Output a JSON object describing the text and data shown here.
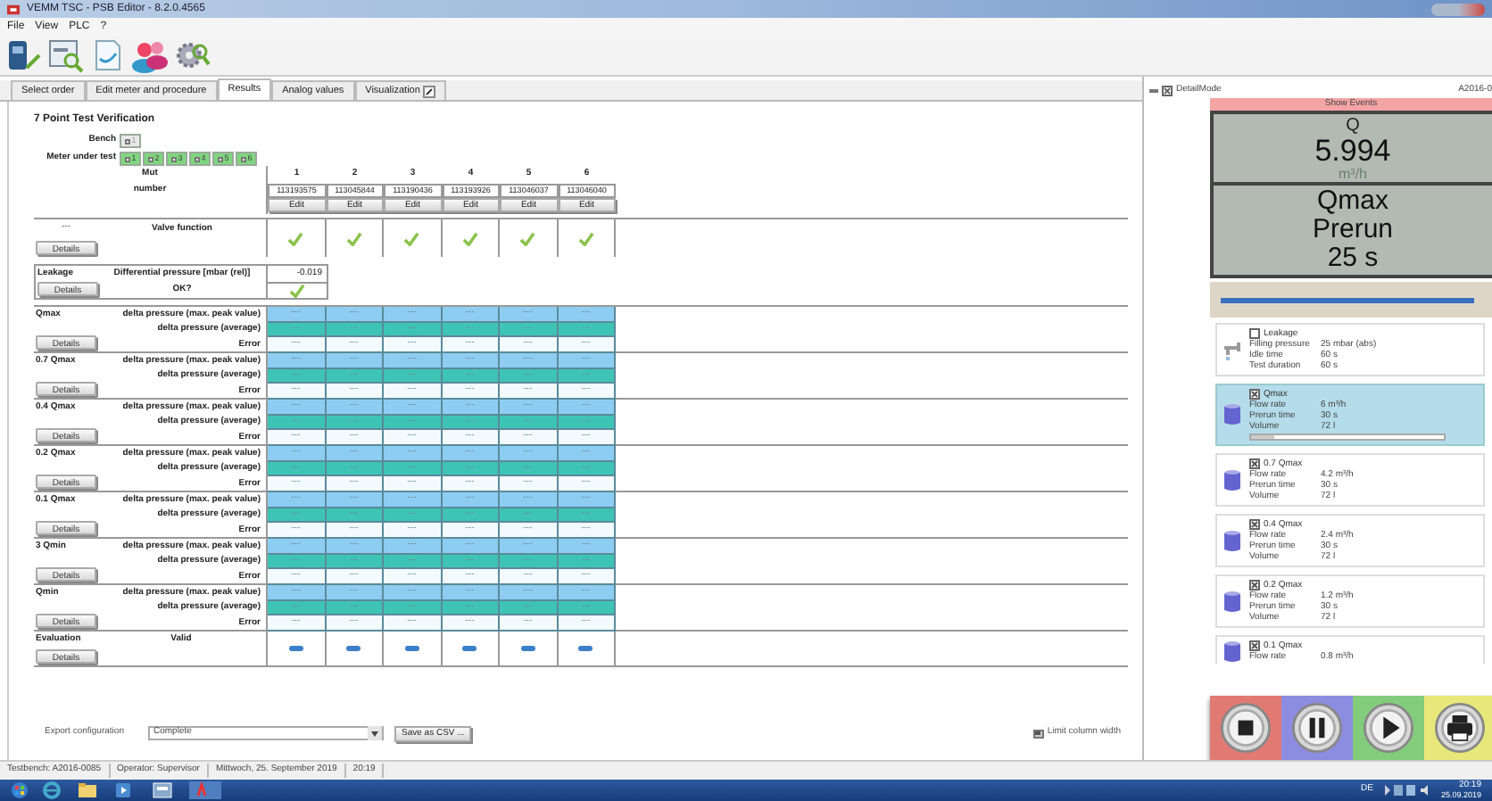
{
  "window": {
    "title": "VEMM TSC - PSB Editor - 8.2.0.4565"
  },
  "menu": [
    "File",
    "View",
    "PLC",
    "?"
  ],
  "tabs": [
    {
      "label": "Select order",
      "selected": false
    },
    {
      "label": "Edit meter and procedure",
      "selected": false
    },
    {
      "label": "Results",
      "selected": true
    },
    {
      "label": "Analog values",
      "selected": false
    },
    {
      "label": "Visualization",
      "selected": false
    }
  ],
  "results": {
    "title": "7 Point Test Verification",
    "bench": {
      "label": "Bench",
      "items": [
        {
          "label": "1",
          "checked": false
        }
      ]
    },
    "meters": {
      "label": "Meter under test",
      "items": [
        {
          "label": "1",
          "checked": true
        },
        {
          "label": "2",
          "checked": true
        },
        {
          "label": "3",
          "checked": true
        },
        {
          "label": "4",
          "checked": true
        },
        {
          "label": "5",
          "checked": true
        },
        {
          "label": "6",
          "checked": true
        }
      ]
    },
    "mut": {
      "label": "Mut",
      "columns": [
        "1",
        "2",
        "3",
        "4",
        "5",
        "6"
      ]
    },
    "number": {
      "label": "number",
      "values": [
        "113193575",
        "113045844",
        "113190436",
        "113193926",
        "113046037",
        "113046040"
      ]
    },
    "edit_buttons": [
      "Edit",
      "Edit",
      "Edit",
      "Edit",
      "Edit",
      "Edit"
    ],
    "valve": {
      "status": "---",
      "label": "Valve function",
      "details": "Details",
      "checks": [
        true,
        true,
        true,
        true,
        true,
        true
      ]
    },
    "leakage": {
      "title": "Leakage",
      "label": "Differential pressure [mbar (rel)]",
      "value": "-0.019",
      "ok_label": "OK?",
      "ok": true,
      "details": "Details"
    },
    "sections": [
      {
        "title": "Qmax",
        "details": "Details",
        "rows": [
          {
            "kind": "peak",
            "label": "delta pressure (max. peak value)",
            "cells": [
              "---",
              "---",
              "---",
              "---",
              "---",
              "---"
            ]
          },
          {
            "kind": "average",
            "label": "delta pressure (average)",
            "cells": [
              "---",
              "---",
              "---",
              "---",
              "---",
              "---"
            ]
          },
          {
            "kind": "error",
            "label": "Error",
            "cells": [
              "---",
              "---",
              "---",
              "---",
              "---",
              "---"
            ]
          }
        ]
      },
      {
        "title": "0.7 Qmax",
        "details": "Details",
        "rows": [
          {
            "kind": "peak",
            "label": "delta pressure (max. peak value)",
            "cells": [
              "---",
              "---",
              "---",
              "---",
              "---",
              "---"
            ]
          },
          {
            "kind": "average",
            "label": "delta pressure (average)",
            "cells": [
              "---",
              "---",
              "---",
              "---",
              "---",
              "---"
            ]
          },
          {
            "kind": "error",
            "label": "Error",
            "cells": [
              "---",
              "---",
              "---",
              "---",
              "---",
              "---"
            ]
          }
        ]
      },
      {
        "title": "0.4 Qmax",
        "details": "Details",
        "rows": [
          {
            "kind": "peak",
            "label": "delta pressure (max. peak value)",
            "cells": [
              "---",
              "---",
              "---",
              "---",
              "---",
              "---"
            ]
          },
          {
            "kind": "average",
            "label": "delta pressure (average)",
            "cells": [
              "---",
              "---",
              "---",
              "---",
              "---",
              "---"
            ]
          },
          {
            "kind": "error",
            "label": "Error",
            "cells": [
              "---",
              "---",
              "---",
              "---",
              "---",
              "---"
            ]
          }
        ]
      },
      {
        "title": "0.2 Qmax",
        "details": "Details",
        "rows": [
          {
            "kind": "peak",
            "label": "delta pressure (max. peak value)",
            "cells": [
              "---",
              "---",
              "---",
              "---",
              "---",
              "---"
            ]
          },
          {
            "kind": "average",
            "label": "delta pressure (average)",
            "cells": [
              "---",
              "---",
              "---",
              "---",
              "---",
              "---"
            ]
          },
          {
            "kind": "error",
            "label": "Error",
            "cells": [
              "---",
              "---",
              "---",
              "---",
              "---",
              "---"
            ]
          }
        ]
      },
      {
        "title": "0.1 Qmax",
        "details": "Details",
        "rows": [
          {
            "kind": "peak",
            "label": "delta pressure (max. peak value)",
            "cells": [
              "---",
              "---",
              "---",
              "---",
              "---",
              "---"
            ]
          },
          {
            "kind": "average",
            "label": "delta pressure (average)",
            "cells": [
              "---",
              "---",
              "---",
              "---",
              "---",
              "---"
            ]
          },
          {
            "kind": "error",
            "label": "Error",
            "cells": [
              "---",
              "---",
              "---",
              "---",
              "---",
              "---"
            ]
          }
        ]
      },
      {
        "title": "3 Qmin",
        "details": "Details",
        "rows": [
          {
            "kind": "peak",
            "label": "delta pressure (max. peak value)",
            "cells": [
              "---",
              "---",
              "---",
              "---",
              "---",
              "---"
            ]
          },
          {
            "kind": "average",
            "label": "delta pressure (average)",
            "cells": [
              "---",
              "---",
              "---",
              "---",
              "---",
              "---"
            ]
          },
          {
            "kind": "error",
            "label": "Error",
            "cells": [
              "---",
              "---",
              "---",
              "---",
              "---",
              "---"
            ]
          }
        ]
      },
      {
        "title": "Qmin",
        "details": "Details",
        "rows": [
          {
            "kind": "peak",
            "label": "delta pressure (max. peak value)",
            "cells": [
              "---",
              "---",
              "---",
              "---",
              "---",
              "---"
            ]
          },
          {
            "kind": "average",
            "label": "delta pressure (average)",
            "cells": [
              "---",
              "---",
              "---",
              "---",
              "---",
              "---"
            ]
          },
          {
            "kind": "error",
            "label": "Error",
            "cells": [
              "---",
              "---",
              "---",
              "---",
              "---",
              "---"
            ]
          }
        ]
      }
    ],
    "evaluation": {
      "title": "Evaluation",
      "label": "Valid",
      "details": "Details",
      "cells": [
        {
          "kind": "pending"
        },
        {
          "kind": "pending"
        },
        {
          "kind": "pending"
        },
        {
          "kind": "pending"
        },
        {
          "kind": "pending"
        },
        {
          "kind": "pending"
        }
      ]
    }
  },
  "export": {
    "label": "Export configuration",
    "value": "Complete",
    "button": "Save as CSV ...",
    "limit_label": "Limit column width",
    "limit_checked": true
  },
  "detail": {
    "title": "DetailMode",
    "id": "A2016-0",
    "show_events": "Show Events",
    "quantity": "Q",
    "value": "5.994",
    "unit": "m³/h",
    "step": "Qmax",
    "phase": "Prerun",
    "time": "25 s",
    "progress": {
      "level": 0.97
    },
    "steps": [
      {
        "kind": "leakage",
        "title": "Leakage",
        "checked": false,
        "selected": false,
        "params": [
          {
            "name": "Filling pressure",
            "value": "25 mbar (abs)"
          },
          {
            "name": "Idle time",
            "value": "60 s"
          },
          {
            "name": "Test duration",
            "value": "60 s"
          }
        ]
      },
      {
        "kind": "flow",
        "title": "Qmax",
        "checked": true,
        "selected": true,
        "level": 0.12,
        "params": [
          {
            "name": "Flow rate",
            "value": "6 m³/h"
          },
          {
            "name": "Prerun time",
            "value": "30 s"
          },
          {
            "name": "Volume",
            "value": "72 l"
          }
        ]
      },
      {
        "kind": "flow",
        "title": "0.7 Qmax",
        "checked": true,
        "selected": false,
        "params": [
          {
            "name": "Flow rate",
            "value": "4.2 m³/h"
          },
          {
            "name": "Prerun time",
            "value": "30 s"
          },
          {
            "name": "Volume",
            "value": "72 l"
          }
        ]
      },
      {
        "kind": "flow",
        "title": "0.4 Qmax",
        "checked": true,
        "selected": false,
        "params": [
          {
            "name": "Flow rate",
            "value": "2.4 m³/h"
          },
          {
            "name": "Prerun time",
            "value": "30 s"
          },
          {
            "name": "Volume",
            "value": "72 l"
          }
        ]
      },
      {
        "kind": "flow",
        "title": "0.2 Qmax",
        "checked": true,
        "selected": false,
        "params": [
          {
            "name": "Flow rate",
            "value": "1.2 m³/h"
          },
          {
            "name": "Prerun time",
            "value": "30 s"
          },
          {
            "name": "Volume",
            "value": "72 l"
          }
        ]
      },
      {
        "kind": "flow",
        "title": "0.1 Qmax",
        "checked": true,
        "selected": false,
        "params": [
          {
            "name": "Flow rate",
            "value": "0.8 m³/h"
          }
        ]
      }
    ]
  },
  "controls": [
    {
      "kind": "stop"
    },
    {
      "kind": "pause"
    },
    {
      "kind": "play"
    },
    {
      "kind": "print"
    }
  ],
  "status_bar": [
    "Testbench: A2016-0085",
    "Operator: Supervisor",
    "Mittwoch, 25. September 2019",
    "20:19"
  ],
  "taskbar": {
    "language": "DE",
    "time": "20:19",
    "date": "25.09.2019"
  }
}
